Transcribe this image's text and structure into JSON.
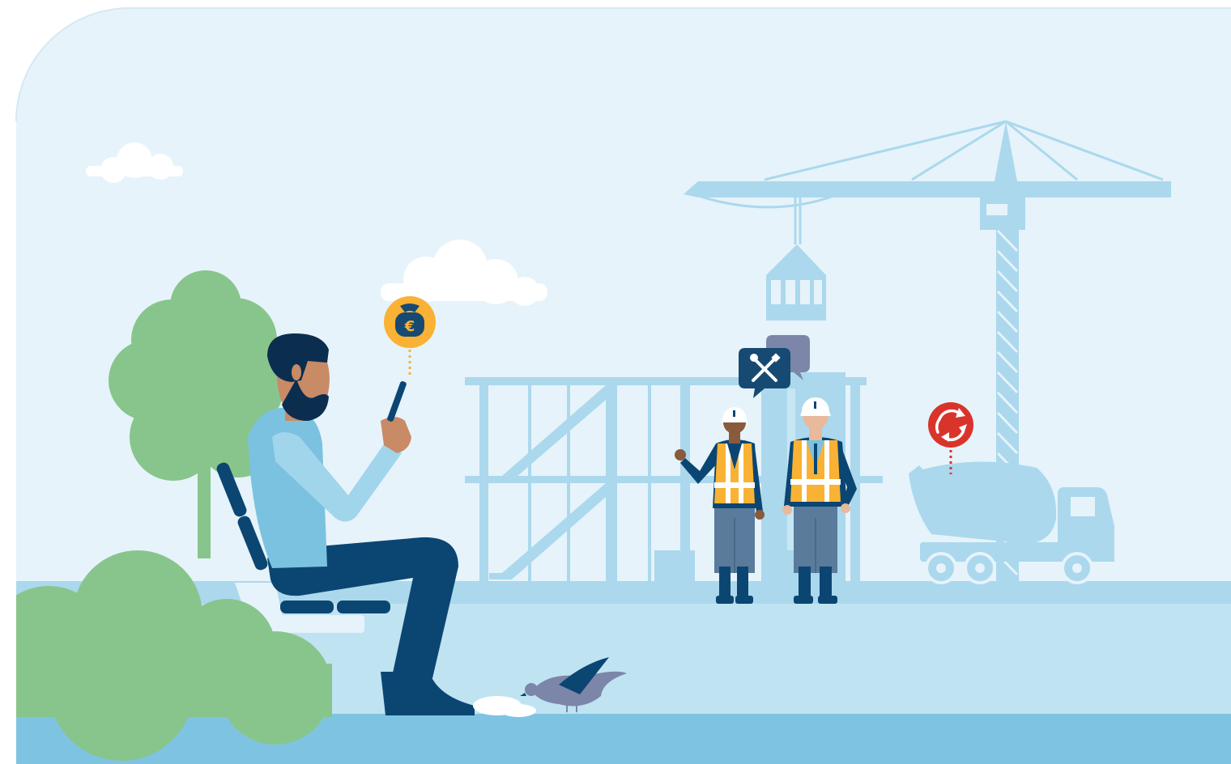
{
  "scene": {
    "badges": [
      {
        "icon": "euro-money-bag-icon",
        "symbol": "€"
      },
      {
        "icon": "tools-icon"
      },
      {
        "icon": "chat-bubble-icon"
      },
      {
        "icon": "recycle-icon"
      }
    ]
  },
  "colors": {
    "sky": "#E6F3FA",
    "structure": "#ABD8ED",
    "ground": "#BFE3F1",
    "ground_strip": "#7EC4E2",
    "tree": "#88C58C",
    "navy": "#0B4673",
    "shirt": "#7BC2E0",
    "skin": "#C98A66",
    "vest": "#F9B233",
    "badge_gold": "#F9B233",
    "badge_navy": "#174A72",
    "badge_red": "#D9342B",
    "cloud": "#FFFFFF"
  }
}
